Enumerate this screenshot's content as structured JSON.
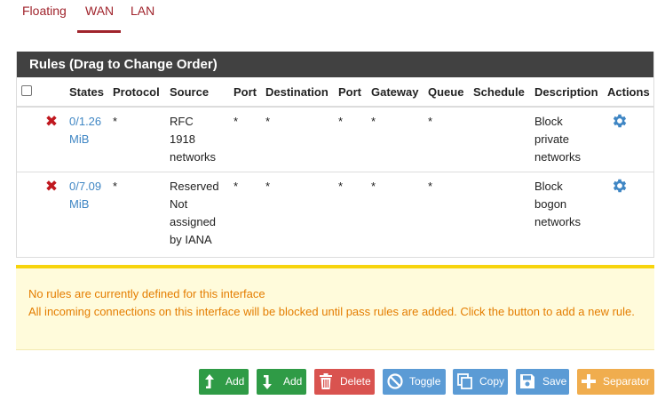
{
  "tabs": [
    {
      "label": "Floating"
    },
    {
      "label": "WAN",
      "active": true
    },
    {
      "label": "LAN"
    }
  ],
  "panel": {
    "title": "Rules (Drag to Change Order)"
  },
  "table": {
    "headers": {
      "states": "States",
      "protocol": "Protocol",
      "source": "Source",
      "port_src": "Port",
      "destination": "Destination",
      "port_dst": "Port",
      "gateway": "Gateway",
      "queue": "Queue",
      "schedule": "Schedule",
      "description": "Description",
      "actions": "Actions"
    },
    "rows": [
      {
        "status_icon": "block-x-icon",
        "states_l1": "0/1.26",
        "states_l2": "MiB",
        "protocol": "*",
        "source_l1": "RFC",
        "source_l2": "1918",
        "source_l3": "networks",
        "source_l4": "",
        "port_src": "*",
        "destination": "*",
        "port_dst": "*",
        "gateway": "*",
        "queue": "*",
        "schedule": "",
        "desc_l1": "Block",
        "desc_l2": "private",
        "desc_l3": "networks",
        "action_icon": "gear-icon"
      },
      {
        "status_icon": "block-x-icon",
        "states_l1": "0/7.09",
        "states_l2": "MiB",
        "protocol": "*",
        "source_l1": "Reserved",
        "source_l2": "Not",
        "source_l3": "assigned",
        "source_l4": "by IANA",
        "port_src": "*",
        "destination": "*",
        "port_dst": "*",
        "gateway": "*",
        "queue": "*",
        "schedule": "",
        "desc_l1": "Block",
        "desc_l2": "bogon",
        "desc_l3": "networks",
        "action_icon": "gear-icon"
      }
    ]
  },
  "alert": {
    "line1": "No rules are currently defined for this interface",
    "line2": "All incoming connections on this interface will be blocked until pass rules are added. Click the button to add a new rule."
  },
  "buttons": {
    "add_top": "Add",
    "add_bottom": "Add",
    "delete": "Delete",
    "toggle": "Toggle",
    "copy": "Copy",
    "save": "Save",
    "separator": "Separator"
  },
  "colors": {
    "tab_active": "#a0242c",
    "panel_heading": "#414141",
    "link": "#3f86c4",
    "block_icon": "#c0181f",
    "alert_bg": "#fffbdb",
    "alert_border": "#f7d40c",
    "alert_text": "#e47d00",
    "btn_success": "#2f9b46",
    "btn_danger": "#d9534f",
    "btn_info": "#5b9bd5",
    "btn_warning": "#f0ad4e"
  }
}
